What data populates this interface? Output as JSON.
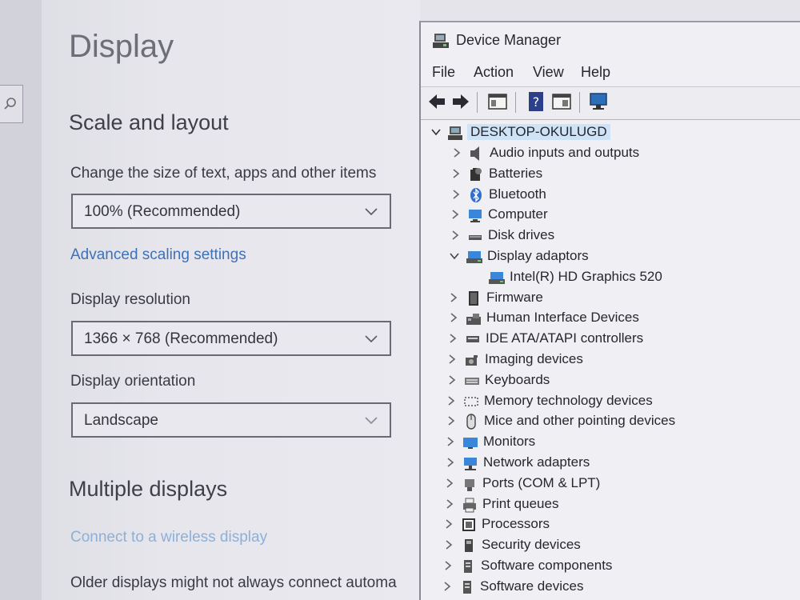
{
  "settings": {
    "page_title": "Display",
    "scale_heading": "Scale and layout",
    "scale_label": "Change the size of text, apps and other items",
    "scale_value": "100% (Recommended)",
    "advanced_link": "Advanced scaling settings",
    "resolution_label": "Display resolution",
    "resolution_value": "1366 × 768 (Recommended)",
    "orientation_label": "Display orientation",
    "orientation_value": "Landscape",
    "multiple_heading": "Multiple displays",
    "wireless_link": "Connect to a wireless display",
    "older_text": "Older displays might not always connect automa"
  },
  "device_manager": {
    "title": "Device Manager",
    "menu": [
      "File",
      "Action",
      "View",
      "Help"
    ],
    "root": "DESKTOP-OKULUGD",
    "tree": [
      {
        "label": "Audio inputs and outputs",
        "icon": "speaker-icon",
        "expanded": false
      },
      {
        "label": "Batteries",
        "icon": "battery-icon",
        "expanded": false
      },
      {
        "label": "Bluetooth",
        "icon": "bluetooth-icon",
        "expanded": false
      },
      {
        "label": "Computer",
        "icon": "computer-icon",
        "expanded": false
      },
      {
        "label": "Disk drives",
        "icon": "disk-icon",
        "expanded": false
      },
      {
        "label": "Display adaptors",
        "icon": "display-adapter-icon",
        "expanded": true
      },
      {
        "label": "Intel(R) HD Graphics 520",
        "icon": "display-adapter-icon",
        "child": true
      },
      {
        "label": "Firmware",
        "icon": "firmware-icon",
        "expanded": false
      },
      {
        "label": "Human Interface Devices",
        "icon": "hid-icon",
        "expanded": false
      },
      {
        "label": "IDE ATA/ATAPI controllers",
        "icon": "ide-icon",
        "expanded": false
      },
      {
        "label": "Imaging devices",
        "icon": "camera-icon",
        "expanded": false
      },
      {
        "label": "Keyboards",
        "icon": "keyboard-icon",
        "expanded": false
      },
      {
        "label": "Memory technology devices",
        "icon": "memory-icon",
        "expanded": false
      },
      {
        "label": "Mice and other pointing devices",
        "icon": "mouse-icon",
        "expanded": false
      },
      {
        "label": "Monitors",
        "icon": "monitor-icon",
        "expanded": false
      },
      {
        "label": "Network adapters",
        "icon": "network-icon",
        "expanded": false
      },
      {
        "label": "Ports (COM & LPT)",
        "icon": "port-icon",
        "expanded": false
      },
      {
        "label": "Print queues",
        "icon": "printer-icon",
        "expanded": false
      },
      {
        "label": "Processors",
        "icon": "processor-icon",
        "expanded": false
      },
      {
        "label": "Security devices",
        "icon": "security-icon",
        "expanded": false
      },
      {
        "label": "Software components",
        "icon": "software-icon",
        "expanded": false
      },
      {
        "label": "Software devices",
        "icon": "software-icon",
        "expanded": false
      }
    ]
  },
  "colors": {
    "link": "#3d72b8",
    "selection": "#cfe3f7"
  }
}
